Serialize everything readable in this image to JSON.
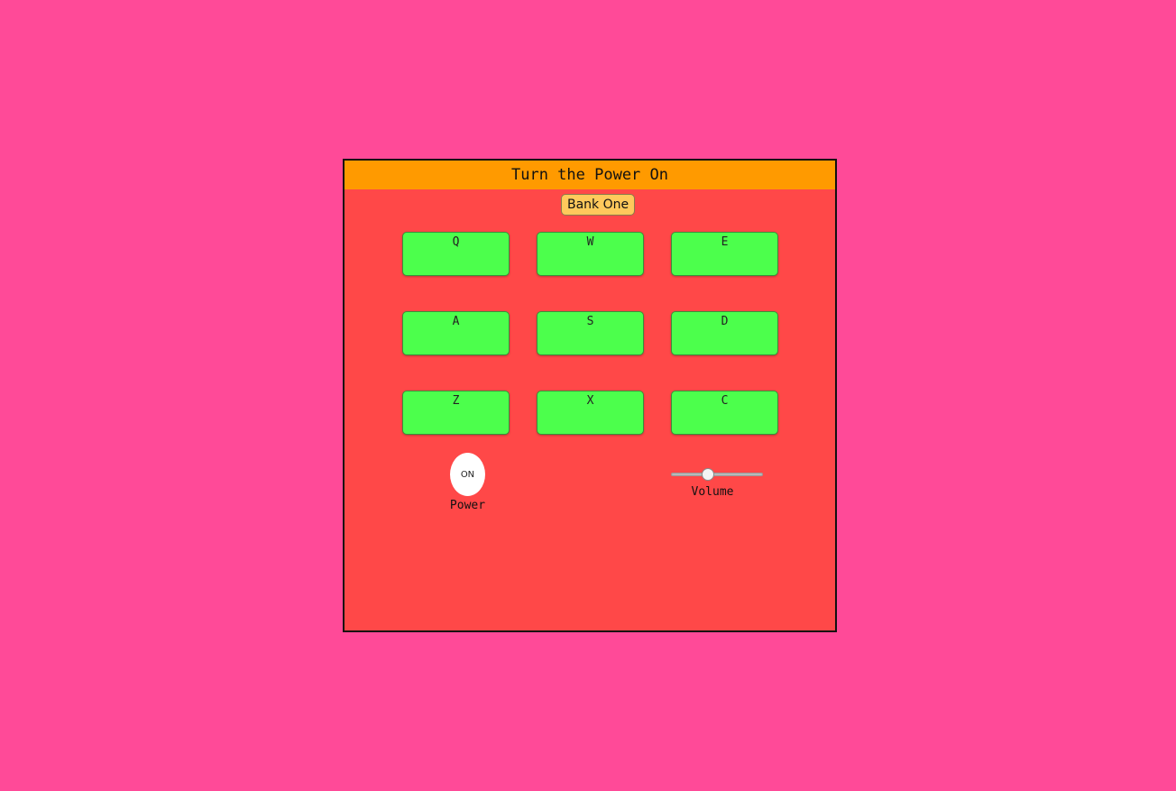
{
  "display": {
    "text": "Turn the Power On"
  },
  "bank": {
    "label": "Bank One"
  },
  "pads": [
    {
      "key": "Q"
    },
    {
      "key": "W"
    },
    {
      "key": "E"
    },
    {
      "key": "A"
    },
    {
      "key": "S"
    },
    {
      "key": "D"
    },
    {
      "key": "Z"
    },
    {
      "key": "X"
    },
    {
      "key": "C"
    }
  ],
  "power": {
    "button_label": "ON",
    "label": "Power"
  },
  "volume": {
    "label": "Volume",
    "level": 0.4
  },
  "colors": {
    "page_background": "#ff4a98",
    "machine_background": "#ff4848",
    "display_background": "#ff9a00",
    "pad": "#4cff4c",
    "bank_button": "#ffc95c",
    "power_button": "#ffffff"
  }
}
